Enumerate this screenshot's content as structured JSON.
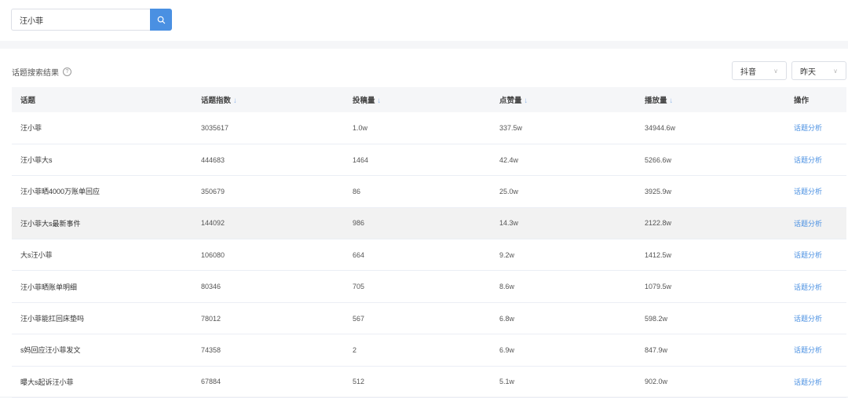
{
  "search": {
    "value": "汪小菲"
  },
  "section": {
    "title": "话题搜索结果",
    "help_icon": "question-circle-icon"
  },
  "filters": {
    "platform": "抖音",
    "date": "昨天"
  },
  "table": {
    "headers": [
      "话题",
      "话题指数",
      "投稿量",
      "点赞量",
      "播放量",
      "操作"
    ],
    "sort_arrow": "↓",
    "rows": [
      {
        "name": "汪小菲",
        "index": "3035617",
        "posts": "1.0w",
        "likes": "337.5w",
        "plays": "34944.6w",
        "action": "话题分析"
      },
      {
        "name": "汪小菲大s",
        "index": "444683",
        "posts": "1464",
        "likes": "42.4w",
        "plays": "5266.6w",
        "action": "话题分析"
      },
      {
        "name": "汪小菲晒4000万账单回应",
        "index": "350679",
        "posts": "86",
        "likes": "25.0w",
        "plays": "3925.9w",
        "action": "话题分析"
      },
      {
        "name": "汪小菲大s最新事件",
        "index": "144092",
        "posts": "986",
        "likes": "14.3w",
        "plays": "2122.8w",
        "action": "话题分析"
      },
      {
        "name": "大s汪小菲",
        "index": "106080",
        "posts": "664",
        "likes": "9.2w",
        "plays": "1412.5w",
        "action": "话题分析"
      },
      {
        "name": "汪小菲晒账单明细",
        "index": "80346",
        "posts": "705",
        "likes": "8.6w",
        "plays": "1079.5w",
        "action": "话题分析"
      },
      {
        "name": "汪小菲能扛回床垫吗",
        "index": "78012",
        "posts": "567",
        "likes": "6.8w",
        "plays": "598.2w",
        "action": "话题分析"
      },
      {
        "name": "s妈回应汪小菲发文",
        "index": "74358",
        "posts": "2",
        "likes": "6.9w",
        "plays": "847.9w",
        "action": "话题分析"
      },
      {
        "name": "曝大s起诉汪小菲",
        "index": "67884",
        "posts": "512",
        "likes": "5.1w",
        "plays": "902.0w",
        "action": "话题分析"
      }
    ]
  }
}
